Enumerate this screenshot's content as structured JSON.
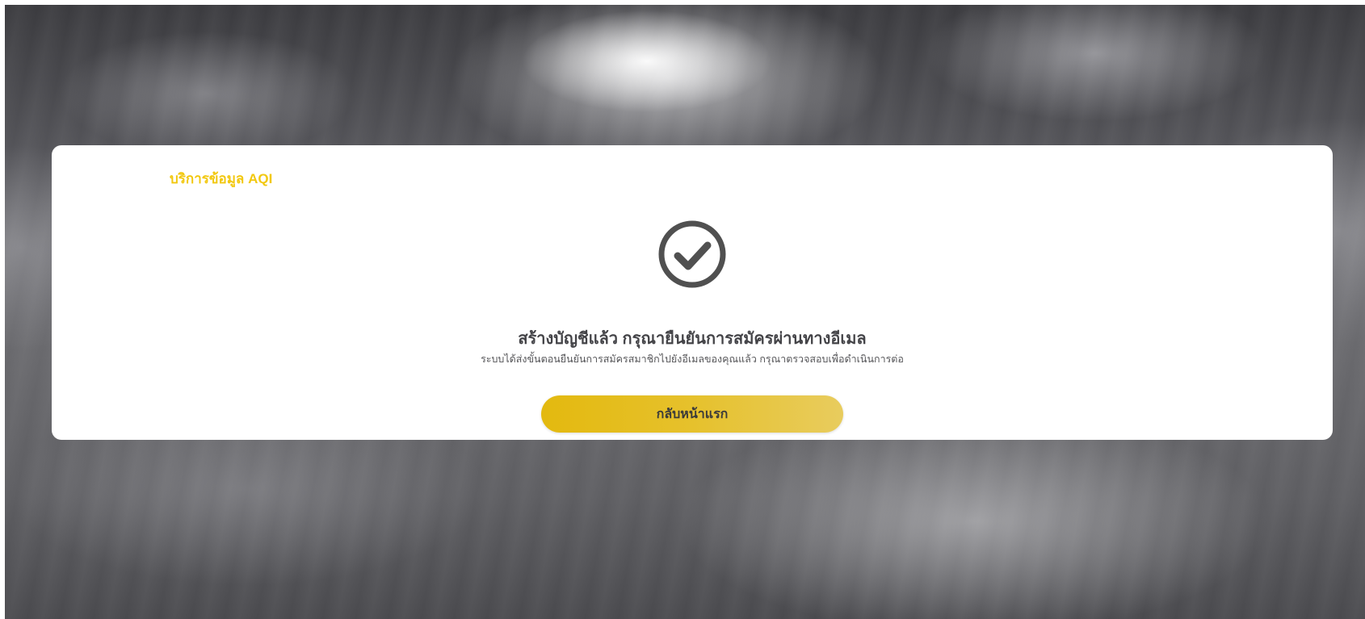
{
  "brand": {
    "label": "บริการข้อมูล AQI",
    "color": "#f2c80f"
  },
  "status": {
    "icon": "check-circle-icon",
    "title": "สร้างบัญชีแล้ว กรุณายืนยันการสมัครผ่านทางอีเมล",
    "message": "ระบบได้ส่งขั้นตอนยืนยันการสมัครสมาชิกไปยังอีเมลของคุณแล้ว กรุณาตรวจสอบเพื่อดำเนินการต่อ"
  },
  "actions": {
    "home_label": "กลับหน้าแรก",
    "button_color": "#e3b90f"
  },
  "background": {
    "image": "cloudy-sky-sunrays"
  }
}
